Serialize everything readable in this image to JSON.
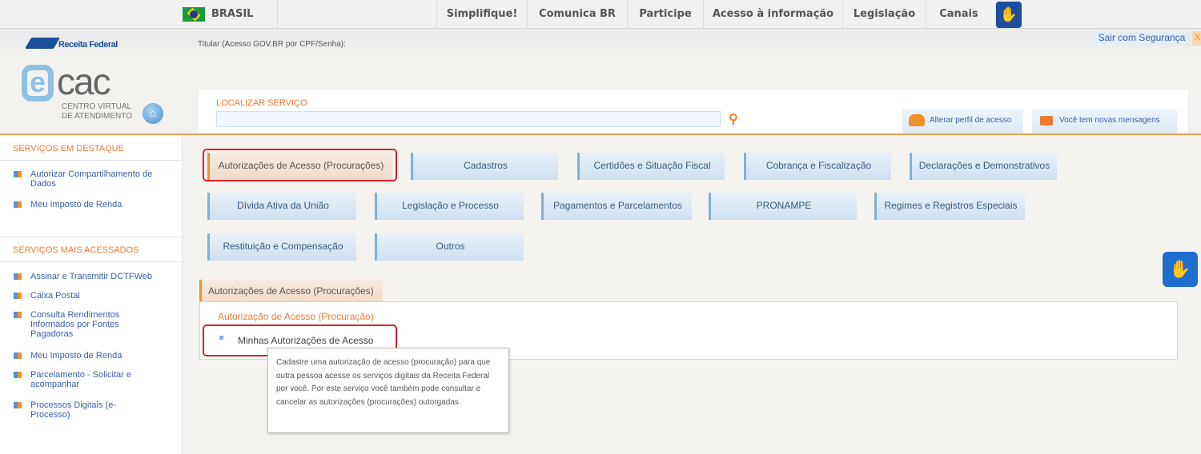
{
  "topnav": {
    "country": "BRASIL",
    "links": [
      "Simplifique!",
      "Comunica BR",
      "Participe",
      "Acesso à informação",
      "Legislação",
      "Canais"
    ],
    "accessibility_icon": "sign-language-icon"
  },
  "header": {
    "brand": "Receita Federal",
    "logo_text": "CAC",
    "logo_sub1": "CENTRO VIRTUAL",
    "logo_sub2": "DE ATENDIMENTO",
    "titular": "Titular (Acesso GOV.BR por CPF/Senha):",
    "logout": "Sair com Segurança",
    "logout_x": "X",
    "search_label": "LOCALIZAR SERVIÇO",
    "search_value": "",
    "profile_button": "Alterar perfil de acesso",
    "messages_button": "Você tem novas mensagens"
  },
  "sidebar": {
    "featured_title": "SERVIÇOS EM DESTAQUE",
    "featured": [
      "Autorizar Compartilhamento de Dados",
      "Meu Imposto de Renda"
    ],
    "popular_title": "SERVIÇOS MAIS ACESSADOS",
    "popular": [
      "Assinar e Transmitir DCTFWeb",
      "Caixa Postal",
      "Consulta Rendimentos Informados por Fontes Pagadoras",
      "Meu Imposto de Renda",
      "Parcelamento - Solicitar e acompanhar",
      "Processos Digitais (e-Processo)"
    ]
  },
  "categories": [
    "Autorizações de Acesso (Procurações)",
    "Cadastros",
    "Certidões e Situação Fiscal",
    "Cobrança e Fiscalização",
    "Declarações e Demonstrativos",
    "Dívida Ativa da União",
    "Legislação e Processo",
    "Pagamentos e Parcelamentos",
    "PRONAMPE",
    "Regimes e Registros Especiais",
    "Restituição e Compensação",
    "Outros"
  ],
  "panel": {
    "tab": "Autorizações de Acesso (Procurações)",
    "group": "Autorização de Acesso (Procuração)",
    "item": "Minhas Autorizações de Acesso",
    "tooltip": "Cadastre uma autorização de acesso (procuração) para que outra pessoa acesse os serviços digitais da Receita Federal por você. Por este serviço você também pode consultar e cancelar as autorizações (procurações) outorgadas."
  },
  "colors": {
    "accent": "#f07a30",
    "link": "#3a5ea8",
    "highlight": "#e0202a"
  }
}
